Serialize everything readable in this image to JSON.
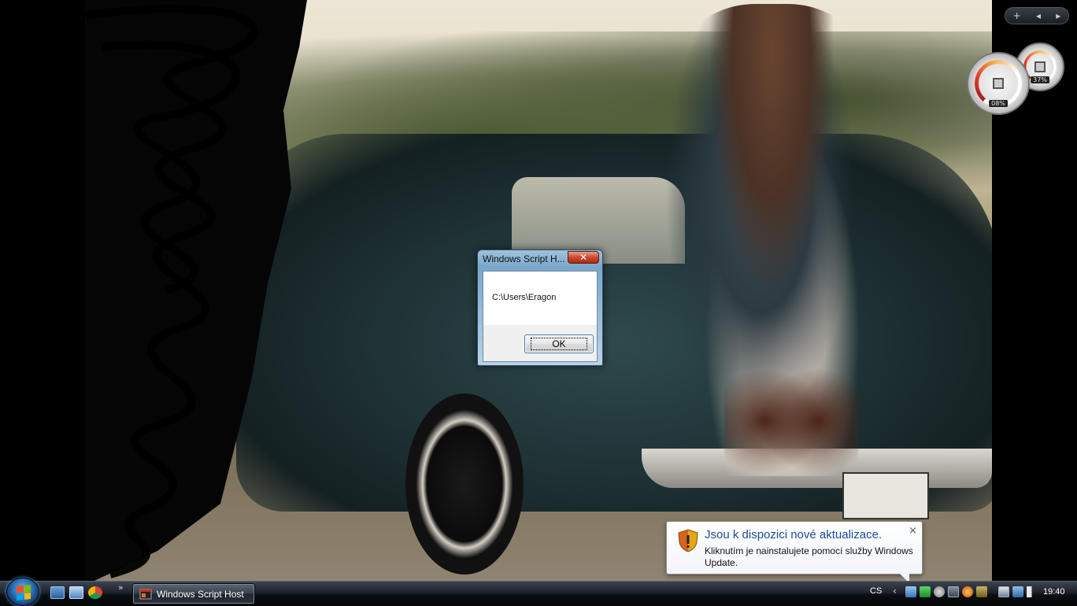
{
  "dialog": {
    "title": "Windows Script H...",
    "close_label": "✕",
    "message": "C:\\Users\\Eragon",
    "ok_label": "OK"
  },
  "notification": {
    "title": "Jsou k dispozici nové aktualizace.",
    "text": "Kliknutím je nainstalujete pomocí služby Windows Update.",
    "close_label": "×"
  },
  "sidebar": {
    "add_label": "+",
    "prev_label": "◂",
    "next_label": "▸",
    "cpu_gadget": {
      "value_label": "08%",
      "value": 0.08
    },
    "mem_gadget": {
      "value_label": "37%",
      "value": 0.37
    }
  },
  "taskbar": {
    "more_label": "»",
    "task_button_label": "Windows Script Host",
    "language": "CS",
    "tray_chevron": "‹",
    "clock": "19:40"
  },
  "colors": {
    "accent_blue": "#1b4a9c",
    "close_red": "#c94a30",
    "taskbar": "#1d222a"
  },
  "icons": {
    "start": "windows-start-orb",
    "shield": "security-shield-icon",
    "quick_launch": [
      "show-desktop-icon",
      "switch-windows-icon",
      "chrome-icon"
    ],
    "tray": [
      "network-icon",
      "update-icon",
      "antivirus-icon",
      "monitor-icon",
      "sync-icon",
      "battery-icon",
      "volume-icon"
    ]
  }
}
